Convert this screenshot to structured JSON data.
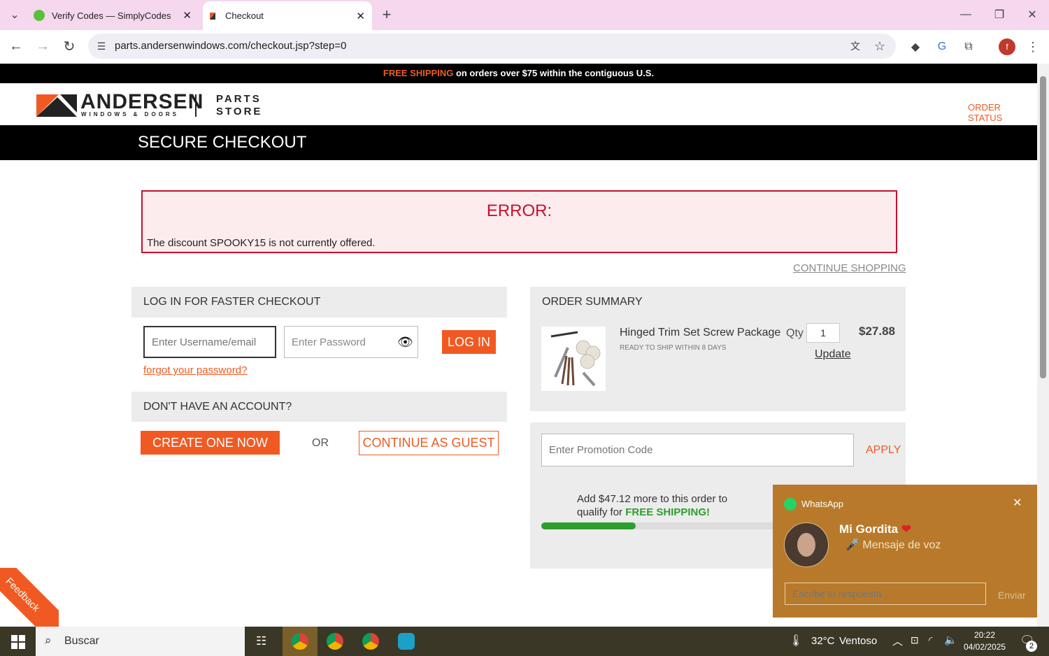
{
  "browser": {
    "tabs": [
      {
        "title": "Verify Codes — SimplyCodes",
        "active": false
      },
      {
        "title": "Checkout",
        "active": true
      }
    ],
    "url": "parts.andersenwindows.com/checkout.jsp?step=0",
    "profile_initial": "f"
  },
  "promo": {
    "highlight": "FREE SHIPPING",
    "text": " on orders over $75 within the contiguous U.S."
  },
  "header": {
    "brand": "ANDERSEN",
    "brand_sub": "WINDOWS & DOORS",
    "store_line1": "PARTS",
    "store_line2": "STORE",
    "order_status": "ORDER STATUS"
  },
  "checkout_title": "SECURE CHECKOUT",
  "error": {
    "title": "ERROR:",
    "message": "The discount SPOOKY15 is not currently offered."
  },
  "continue_shopping": "CONTINUE SHOPPING",
  "login": {
    "heading": "LOG IN FOR FASTER CHECKOUT",
    "username_placeholder": "Enter Username/email",
    "password_placeholder": "Enter Password",
    "login_button": "LOG IN",
    "forgot": "forgot your password?"
  },
  "register": {
    "heading": "DON'T HAVE AN ACCOUNT?",
    "create_button": "CREATE ONE NOW",
    "or": "OR",
    "guest_button": "CONTINUE AS GUEST"
  },
  "order_summary": {
    "heading": "ORDER SUMMARY",
    "item_name": "Hinged Trim Set Screw Package",
    "item_status": "READY TO SHIP WITHIN 8 DAYS",
    "qty_label": "Qty",
    "qty_value": "1",
    "update": "Update",
    "price": "$27.88"
  },
  "promotion": {
    "placeholder": "Enter Promotion Code",
    "apply": "APPLY"
  },
  "shipping_progress": {
    "line1": "Add $47.12 more to this order to",
    "line2": "qualify for ",
    "highlight": "FREE SHIPPING!",
    "fraction": 0.37
  },
  "feedback": "Feedback",
  "whatsapp": {
    "app": "WhatsApp",
    "contact": "Mi Gordita",
    "message": "🎤 Mensaje de voz",
    "reply_placeholder": "Escribe tu respuesta",
    "send": "Enviar"
  },
  "taskbar": {
    "search": "Buscar",
    "temp": "32°C",
    "weather": "Ventoso",
    "time": "20:22",
    "date": "04/02/2025",
    "notifications": "2"
  },
  "colors": {
    "accent": "#f05a22",
    "error": "#c8102e",
    "success": "#2e9e2e"
  }
}
